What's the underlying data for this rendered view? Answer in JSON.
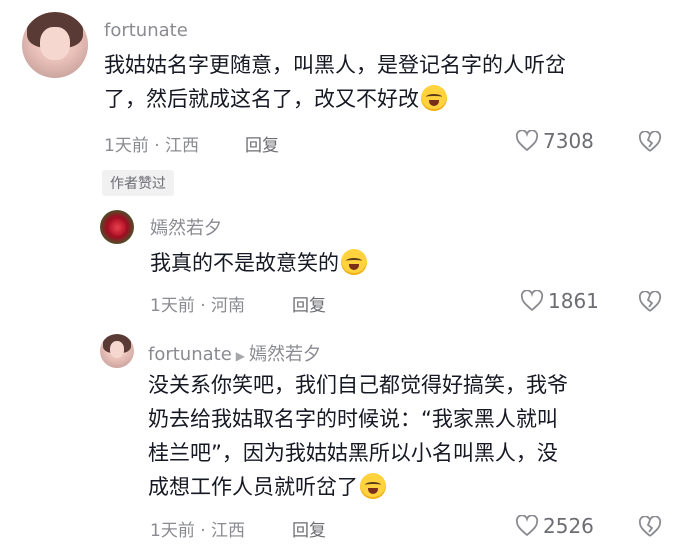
{
  "comments": [
    {
      "username": "fortunate",
      "text_line1": "我姑姑名字更随意，叫黑人，是登记名字的人听岔",
      "text_line2": "了，然后就成这名了，改又不好改",
      "time_location": "1天前 · 江西",
      "reply_label": "回复",
      "likes": "7308",
      "badge": "作者赞过"
    },
    {
      "username": "嫣然若夕",
      "text_line1": "我真的不是故意笑的",
      "time_location": "1天前 · 河南",
      "reply_label": "回复",
      "likes": "1861"
    },
    {
      "username": "fortunate",
      "reply_to": "嫣然若夕",
      "text_line1": "没关系你笑吧，我们自己都觉得好搞笑，我爷",
      "text_line2": "奶去给我姑取名字的时候说：“我家黑人就叫",
      "text_line3": "桂兰吧”，因为我姑姑黑所以小名叫黑人，没",
      "text_line4": "成想工作人员就听岔了",
      "time_location": "1天前 · 江西",
      "reply_label": "回复",
      "likes": "2526"
    }
  ],
  "icons": {
    "like": "heart-outline-icon",
    "dislike": "broken-heart-icon",
    "emoji": "laugh-cry-emoji-icon"
  },
  "colors": {
    "text": "#161823",
    "meta": "#8a8b91",
    "badge_bg": "#f1f1f2"
  }
}
